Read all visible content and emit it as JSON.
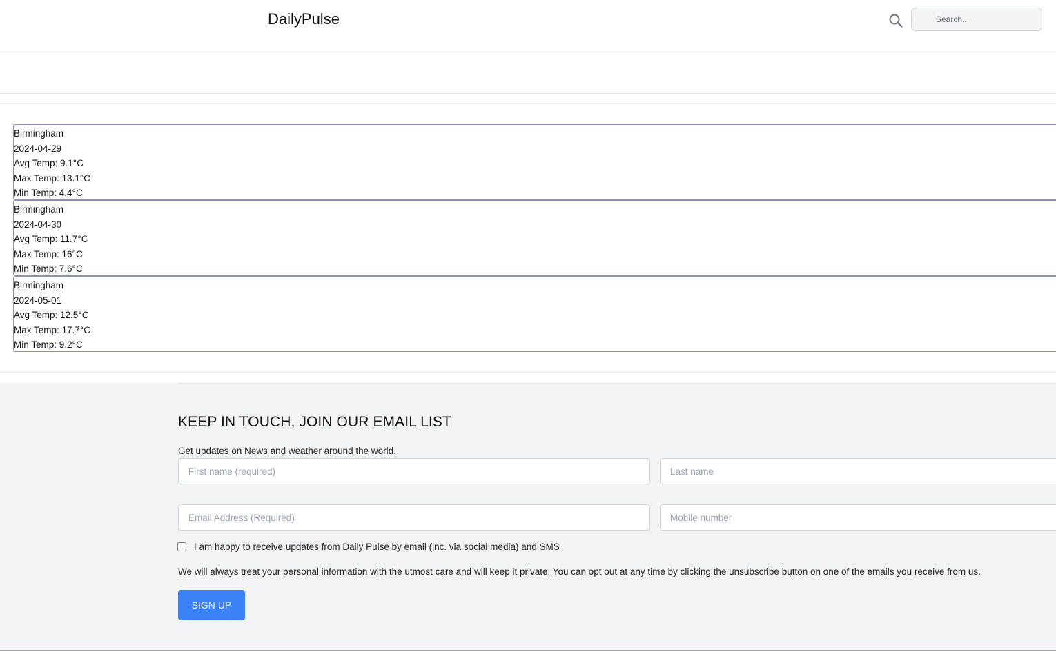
{
  "header": {
    "brand": "DailyPulse",
    "search_placeholder": "Search...",
    "search_icon": "search-icon"
  },
  "weather": [
    {
      "city": "Birmingham",
      "date": "2024-04-29",
      "avg": "Avg Temp: 9.1°C",
      "max": "Max Temp: 13.1°C",
      "min": "Min Temp: 4.4°C"
    },
    {
      "city": "Birmingham",
      "date": "2024-04-30",
      "avg": "Avg Temp: 11.7°C",
      "max": "Max Temp: 16°C",
      "min": "Min Temp: 7.6°C"
    },
    {
      "city": "Birmingham",
      "date": "2024-05-01",
      "avg": "Avg Temp: 12.5°C",
      "max": "Max Temp: 17.7°C",
      "min": "Min Temp: 9.2°C"
    }
  ],
  "newsletter": {
    "title": "KEEP IN TOUCH, JOIN OUR EMAIL LIST",
    "subtitle": "Get updates on News and weather around the world.",
    "first_name_placeholder": "First name (required)",
    "last_name_placeholder": "Last name",
    "email_placeholder": "Email Address (Required)",
    "mobile_placeholder": "Mobile number",
    "consent_label": "I am happy to receive updates from Daily Pulse by email (inc. via social media) and SMS",
    "consent_checked": false,
    "privacy_note": "We will always treat your personal information with the utmost care and will keep it private. You can opt out at any time by clicking the unsubscribe button on one of the emails you receive from us.",
    "signup_label": "SIGN UP"
  },
  "colors": {
    "accent": "#3b82f6",
    "card_border": "#8b8fc9",
    "footer_bg": "#f2f3f5"
  }
}
